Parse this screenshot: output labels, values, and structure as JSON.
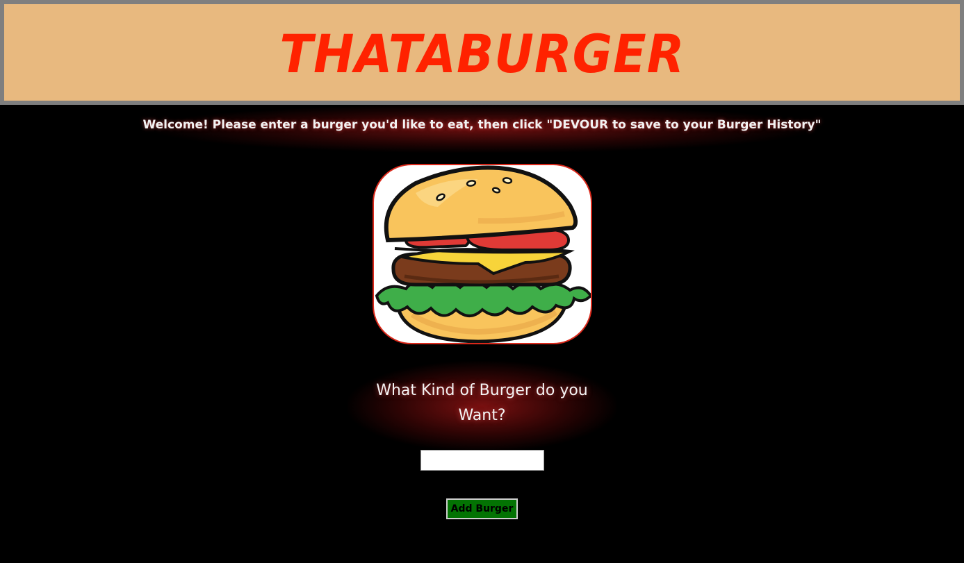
{
  "header": {
    "brand": "THATABURGER"
  },
  "welcome": {
    "text": "Welcome! Please enter a burger you'd like to eat, then click \"DEVOUR to save to your Burger History\""
  },
  "form": {
    "question": "What Kind of Burger do you Want?",
    "input_value": "",
    "input_placeholder": "",
    "submit_label": "Add Burger"
  },
  "colors": {
    "header_bg": "#e8b97f",
    "brand_red": "#ff2200",
    "button_green": "#037303",
    "page_bg": "#000000"
  },
  "images": {
    "hero": "burger-illustration"
  }
}
